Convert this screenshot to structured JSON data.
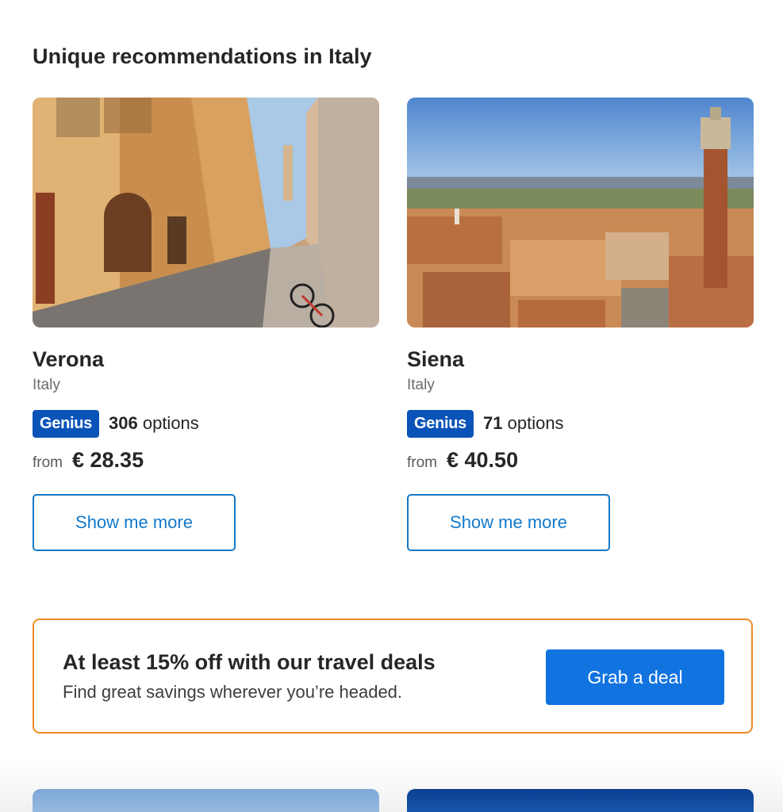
{
  "section": {
    "title": "Unique recommendations in Italy"
  },
  "cards": [
    {
      "city": "Verona",
      "country": "Italy",
      "badge": "Genius",
      "options_count": "306",
      "options_suffix": "options",
      "from_label": "from",
      "price": "€ 28.35",
      "button_label": "Show me more"
    },
    {
      "city": "Siena",
      "country": "Italy",
      "badge": "Genius",
      "options_count": "71",
      "options_suffix": "options",
      "from_label": "from",
      "price": "€ 40.50",
      "button_label": "Show me more"
    }
  ],
  "deal": {
    "title": "At least 15% off with our travel deals",
    "subtitle": "Find great savings wherever you’re headed.",
    "button_label": "Grab a deal"
  },
  "colors": {
    "genius_blue": "#0a53b8",
    "link_blue": "#1479c9",
    "primary_button": "#1173e0",
    "deal_border": "#f08a24"
  }
}
